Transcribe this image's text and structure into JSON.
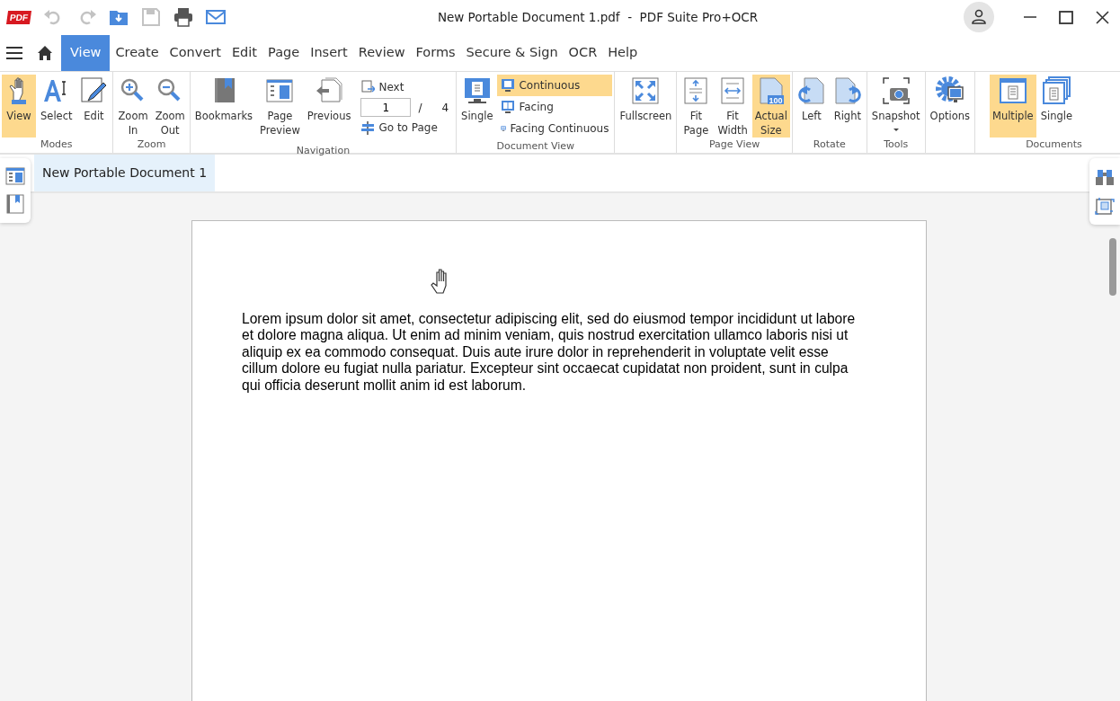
{
  "titlebar": {
    "logo": "PDF",
    "title": "New Portable Document 1.pdf  -  PDF Suite Pro+OCR"
  },
  "quick_access": [
    {
      "disabled": true
    },
    {
      "disabled": true
    },
    {
      "disabled": false
    },
    {
      "disabled": true
    },
    {
      "disabled": false
    },
    {
      "disabled": false
    }
  ],
  "menu": [
    {
      "label": "View",
      "selected": true
    },
    {
      "label": "Create",
      "selected": false
    },
    {
      "label": "Convert",
      "selected": false
    },
    {
      "label": "Edit",
      "selected": false
    },
    {
      "label": "Page",
      "selected": false
    },
    {
      "label": "Insert",
      "selected": false
    },
    {
      "label": "Review",
      "selected": false
    },
    {
      "label": "Forms",
      "selected": false
    },
    {
      "label": "Secure & Sign",
      "selected": false
    },
    {
      "label": "OCR",
      "selected": false
    },
    {
      "label": "Help",
      "selected": false
    }
  ],
  "ribbon": [
    {
      "label": "Modes",
      "items": [
        {
          "kind": "big",
          "label": "View",
          "selected": true
        },
        {
          "kind": "big",
          "label": "Select",
          "selected": false
        },
        {
          "kind": "big",
          "label": "Edit",
          "selected": false
        }
      ]
    },
    {
      "label": "Zoom",
      "items": [
        {
          "kind": "big",
          "label": "Zoom In",
          "selected": false
        },
        {
          "kind": "big",
          "label": "Zoom Out",
          "selected": false
        }
      ]
    },
    {
      "label": "Navigation",
      "items": [
        {
          "kind": "big",
          "label": "Bookmarks",
          "selected": false
        },
        {
          "kind": "big",
          "label": "Page Preview",
          "selected": false
        },
        {
          "kind": "big",
          "label": "Previous",
          "selected": false
        },
        {
          "kind": "nav",
          "next": "Next",
          "page": "1",
          "separator": "/",
          "total": "4",
          "goto": "Go to Page"
        }
      ]
    },
    {
      "label": "Document View",
      "items": [
        {
          "kind": "big",
          "label": "Single",
          "selected": false
        },
        {
          "kind": "stack",
          "options": [
            {
              "label": "Continuous",
              "selected": true
            },
            {
              "label": "Facing",
              "selected": false
            },
            {
              "label": "Facing Continuous",
              "selected": false
            }
          ]
        }
      ]
    },
    {
      "items": [
        {
          "kind": "big",
          "label": "Fullscreen",
          "selected": false
        }
      ]
    },
    {
      "label": "Page View",
      "items": [
        {
          "kind": "big",
          "label": "Fit Page",
          "selected": false
        },
        {
          "kind": "big",
          "label": "Fit Width",
          "selected": false
        },
        {
          "kind": "big",
          "label": "Actual Size",
          "selected": true,
          "icon_text": "100"
        }
      ]
    },
    {
      "label": "Rotate",
      "items": [
        {
          "kind": "big",
          "label": "Left",
          "selected": false
        },
        {
          "kind": "big",
          "label": "Right",
          "selected": false
        }
      ]
    },
    {
      "label": "Tools",
      "items": [
        {
          "kind": "big",
          "label": "Snapshot",
          "selected": false,
          "dropdown": true
        }
      ]
    },
    {
      "items": [
        {
          "kind": "big",
          "label": "Options",
          "selected": false
        }
      ]
    },
    {
      "label": "Documents",
      "items": [
        {
          "kind": "big",
          "label": "Multiple",
          "selected": true
        },
        {
          "kind": "big",
          "label": "Single",
          "selected": false
        }
      ]
    }
  ],
  "document_tabs": [
    {
      "label": "New Portable Document 1",
      "selected": true
    }
  ],
  "document": {
    "text": "Lorem ipsum dolor sit amet, consectetur adipiscing elit, sed do eiusmod tempor incididunt ut labore et dolore magna aliqua. Ut enim ad minim veniam, quis nostrud exercitation ullamco laboris nisi ut aliquip ex ea commodo consequat. Duis aute irure dolor in reprehenderit in voluptate velit esse cillum dolore eu fugiat nulla pariatur. Excepteur sint occaecat cupidatat non proident, sunt in culpa qui officia deserunt mollit anim id est laborum."
  }
}
